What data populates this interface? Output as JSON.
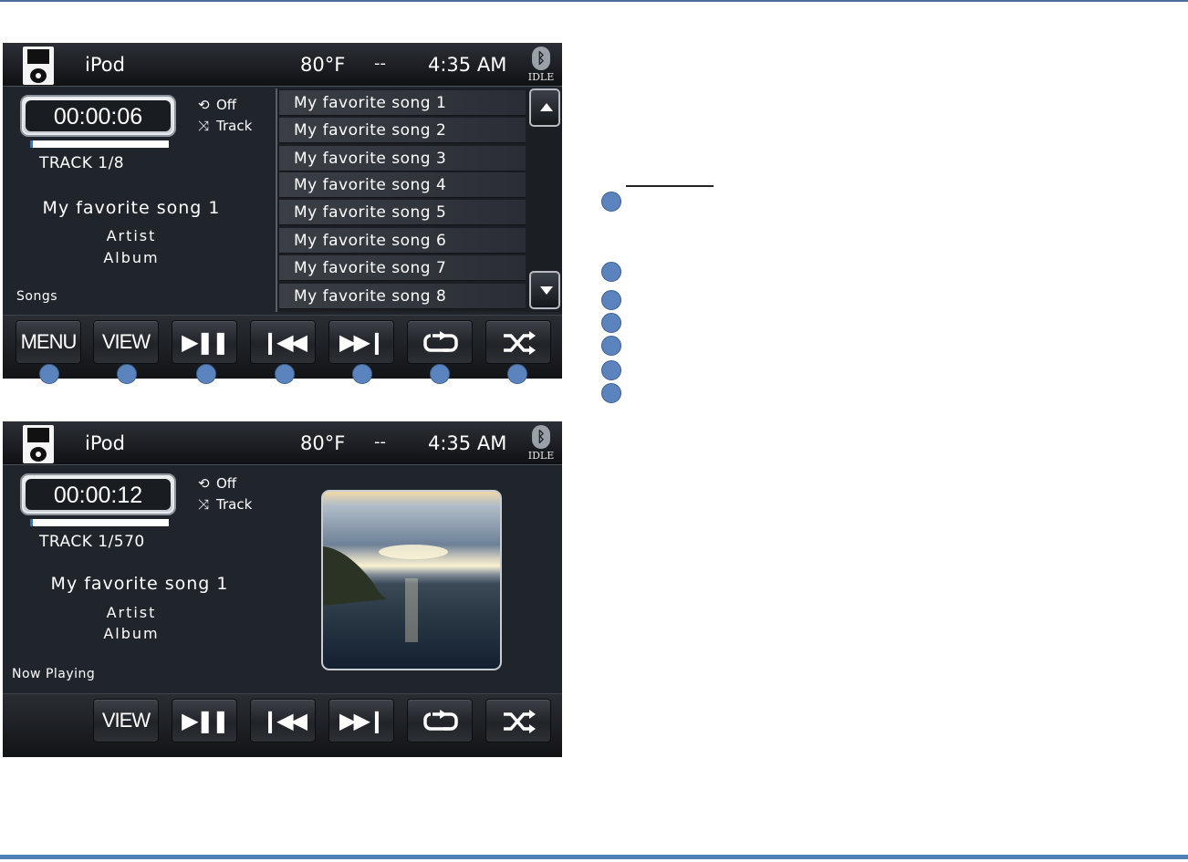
{
  "screens": [
    {
      "status": {
        "source": "iPod",
        "temperature": "80°F",
        "separator": "--",
        "time": "4:35 AM",
        "bluetooth_label": "IDLE",
        "bluetooth_icon": "bluetooth-icon"
      },
      "elapsed": "00:00:06",
      "progress_fraction": 0.02,
      "repeat": {
        "icon": "repeat-icon",
        "label": "Off"
      },
      "shuffle": {
        "icon": "shuffle-icon",
        "label": "Track"
      },
      "track_info": "TRACK  1/8",
      "song_title": "My favorite song 1",
      "artist": "Artist",
      "album": "Album",
      "mode_label": "Songs",
      "song_list": [
        "My favorite song 1",
        "My favorite song 2",
        "My favorite song 3",
        "My favorite song 4",
        "My favorite song 5",
        "My favorite song 6",
        "My favorite song 7",
        "My favorite song 8"
      ],
      "scroll_up_icon": "scroll-up-icon",
      "scroll_down_icon": "scroll-down-icon",
      "buttons": {
        "menu": "MENU",
        "view": "VIEW"
      }
    },
    {
      "status": {
        "source": "iPod",
        "temperature": "80°F",
        "separator": "--",
        "time": "4:35 AM",
        "bluetooth_label": "IDLE",
        "bluetooth_icon": "bluetooth-icon"
      },
      "elapsed": "00:00:12",
      "progress_fraction": 0.02,
      "repeat": {
        "icon": "repeat-icon",
        "label": "Off"
      },
      "shuffle": {
        "icon": "shuffle-icon",
        "label": "Track"
      },
      "track_info": "TRACK  1/570",
      "song_title": "My favorite song 1",
      "artist": "Artist",
      "album": "Album",
      "mode_label": "Now Playing",
      "album_art": "album-art-sunset-over-sea",
      "buttons": {
        "view": "VIEW"
      }
    }
  ],
  "control_icons": [
    "play-pause-icon",
    "previous-track-icon",
    "next-track-icon",
    "repeat-icon",
    "shuffle-icon"
  ],
  "colors": {
    "accent": "#2f76d0",
    "callout": "#5b84bf",
    "rule": "#4f7fb5"
  }
}
